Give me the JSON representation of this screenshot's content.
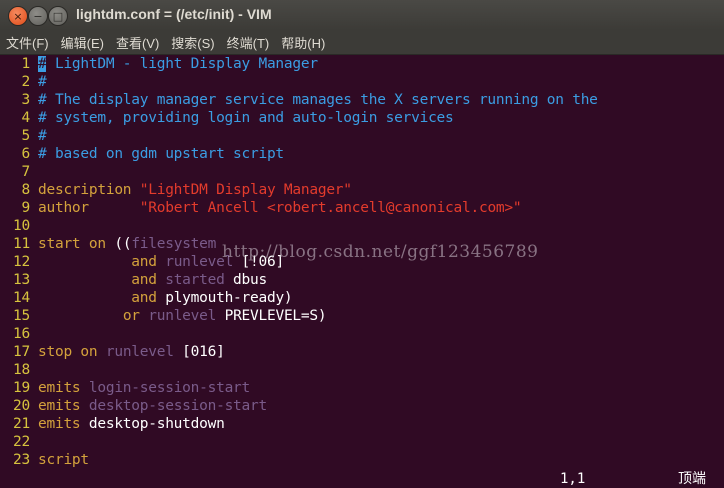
{
  "window": {
    "title": "lightdm.conf = (/etc/init) - VIM",
    "close_glyph": "×",
    "minimize_glyph": "−",
    "maximize_glyph": "□"
  },
  "menu": [
    {
      "label": "文件(F)"
    },
    {
      "label": "编辑(E)"
    },
    {
      "label": "查看(V)"
    },
    {
      "label": "搜索(S)"
    },
    {
      "label": "终端(T)"
    },
    {
      "label": "帮助(H)"
    }
  ],
  "editor": {
    "lines": [
      {
        "num": "1",
        "segments": [
          {
            "t": "#",
            "cls": "cursor"
          },
          {
            "t": " LightDM - light Display Manager",
            "cls": "c-comment"
          }
        ]
      },
      {
        "num": "2",
        "segments": [
          {
            "t": "#",
            "cls": "c-comment"
          }
        ]
      },
      {
        "num": "3",
        "segments": [
          {
            "t": "# The display manager service manages the X servers running on the",
            "cls": "c-comment"
          }
        ]
      },
      {
        "num": "4",
        "segments": [
          {
            "t": "# system, providing login and auto-login services",
            "cls": "c-comment"
          }
        ]
      },
      {
        "num": "5",
        "segments": [
          {
            "t": "#",
            "cls": "c-comment"
          }
        ]
      },
      {
        "num": "6",
        "segments": [
          {
            "t": "# based on gdm upstart script",
            "cls": "c-comment"
          }
        ]
      },
      {
        "num": "7",
        "segments": []
      },
      {
        "num": "8",
        "segments": [
          {
            "t": "description",
            "cls": "c-key"
          },
          {
            "t": " ",
            "cls": "c-norm"
          },
          {
            "t": "\"LightDM Display Manager\"",
            "cls": "c-str"
          }
        ]
      },
      {
        "num": "9",
        "segments": [
          {
            "t": "author",
            "cls": "c-key"
          },
          {
            "t": "      ",
            "cls": "c-norm"
          },
          {
            "t": "\"Robert Ancell <robert.ancell@canonical.com>\"",
            "cls": "c-str"
          }
        ]
      },
      {
        "num": "10",
        "segments": []
      },
      {
        "num": "11",
        "segments": [
          {
            "t": "start",
            "cls": "c-key"
          },
          {
            "t": " ",
            "cls": "c-norm"
          },
          {
            "t": "on",
            "cls": "c-key"
          },
          {
            "t": " ((",
            "cls": "c-norm"
          },
          {
            "t": "filesystem",
            "cls": "c-id"
          }
        ]
      },
      {
        "num": "12",
        "segments": [
          {
            "t": "           ",
            "cls": "c-norm"
          },
          {
            "t": "and",
            "cls": "c-key"
          },
          {
            "t": " ",
            "cls": "c-norm"
          },
          {
            "t": "runlevel",
            "cls": "c-id"
          },
          {
            "t": " [!06]",
            "cls": "c-norm"
          }
        ]
      },
      {
        "num": "13",
        "segments": [
          {
            "t": "           ",
            "cls": "c-norm"
          },
          {
            "t": "and",
            "cls": "c-key"
          },
          {
            "t": " ",
            "cls": "c-norm"
          },
          {
            "t": "started",
            "cls": "c-id"
          },
          {
            "t": " dbus",
            "cls": "c-norm"
          }
        ]
      },
      {
        "num": "14",
        "segments": [
          {
            "t": "           ",
            "cls": "c-norm"
          },
          {
            "t": "and",
            "cls": "c-key"
          },
          {
            "t": " plymouth-ready)",
            "cls": "c-norm"
          }
        ]
      },
      {
        "num": "15",
        "segments": [
          {
            "t": "          ",
            "cls": "c-norm"
          },
          {
            "t": "or",
            "cls": "c-key"
          },
          {
            "t": " ",
            "cls": "c-norm"
          },
          {
            "t": "runlevel",
            "cls": "c-id"
          },
          {
            "t": " PREVLEVEL=S)",
            "cls": "c-norm"
          }
        ]
      },
      {
        "num": "16",
        "segments": []
      },
      {
        "num": "17",
        "segments": [
          {
            "t": "stop",
            "cls": "c-key"
          },
          {
            "t": " ",
            "cls": "c-norm"
          },
          {
            "t": "on",
            "cls": "c-key"
          },
          {
            "t": " ",
            "cls": "c-norm"
          },
          {
            "t": "runlevel",
            "cls": "c-id"
          },
          {
            "t": " [016]",
            "cls": "c-norm"
          }
        ]
      },
      {
        "num": "18",
        "segments": []
      },
      {
        "num": "19",
        "segments": [
          {
            "t": "emits",
            "cls": "c-key"
          },
          {
            "t": " ",
            "cls": "c-norm"
          },
          {
            "t": "login-session-start",
            "cls": "c-id"
          }
        ]
      },
      {
        "num": "20",
        "segments": [
          {
            "t": "emits",
            "cls": "c-key"
          },
          {
            "t": " ",
            "cls": "c-norm"
          },
          {
            "t": "desktop-session-start",
            "cls": "c-id"
          }
        ]
      },
      {
        "num": "21",
        "segments": [
          {
            "t": "emits",
            "cls": "c-key"
          },
          {
            "t": " desktop-shutdown",
            "cls": "c-norm"
          }
        ]
      },
      {
        "num": "22",
        "segments": []
      },
      {
        "num": "23",
        "segments": [
          {
            "t": "script",
            "cls": "c-key"
          }
        ]
      }
    ]
  },
  "status": {
    "cursor_position": "1,1",
    "scroll_position": "顶端"
  },
  "watermark": "http://blog.csdn.net/ggf123456789",
  "colors": {
    "background": "#300a24",
    "line_number": "#d7c33e",
    "comment": "#3b9de3",
    "keyword": "#d4a23c",
    "string": "#e33b2c",
    "identifier": "#7a5b8a",
    "text": "#ffffff"
  }
}
